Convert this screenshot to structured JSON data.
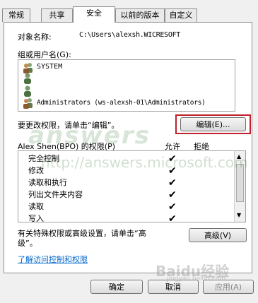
{
  "tabs": [
    {
      "label": "常规",
      "active": false
    },
    {
      "label": "共享",
      "active": false
    },
    {
      "label": "安全",
      "active": true
    },
    {
      "label": "以前的版本",
      "active": false
    },
    {
      "label": "自定义",
      "active": false
    }
  ],
  "object_name": {
    "label": "对象名称:",
    "value": "C:\\Users\\alexsh.WICRESOFT"
  },
  "groups": {
    "label": "组或用户名(G):",
    "items": [
      {
        "name": "SYSTEM",
        "icon": "users-icon"
      },
      {
        "name": "",
        "icon": "user-icon"
      },
      {
        "name": "",
        "icon": "user-icon"
      },
      {
        "name": "Administrators (ws-alexsh-01\\Administrators)",
        "icon": "users-icon"
      }
    ]
  },
  "change_hint": "要更改权限，请单击“编辑”。",
  "edit_button": "编辑(E)...",
  "permissions": {
    "title": "Alex Shen(BPO) 的权限(P)",
    "allow_header": "允许",
    "deny_header": "拒绝",
    "rows": [
      {
        "name": "完全控制",
        "allow": true,
        "deny": false
      },
      {
        "name": "修改",
        "allow": true,
        "deny": false
      },
      {
        "name": "读取和执行",
        "allow": true,
        "deny": false
      },
      {
        "name": "列出文件夹内容",
        "allow": true,
        "deny": false
      },
      {
        "name": "读取",
        "allow": true,
        "deny": false
      },
      {
        "name": "写入",
        "allow": true,
        "deny": false
      }
    ],
    "check_glyph": "✔"
  },
  "advanced": {
    "hint_line1": "有关特殊权限或高级设置，请单击“高",
    "hint_line2": "级”。",
    "button": "高级(V)"
  },
  "learn_link": "了解访问控制和权限",
  "footer": {
    "ok": "确定",
    "cancel": "取消",
    "apply": "应用(A)"
  },
  "watermarks": {
    "main": "answers",
    "url": "http://answers.microsoft.com",
    "baidu": "Baidu经验",
    "baidu_url": "jingyan.baidu.com"
  },
  "colors": {
    "highlight": "#c0202a",
    "link": "#0066cc",
    "selection": "#3399ff"
  }
}
